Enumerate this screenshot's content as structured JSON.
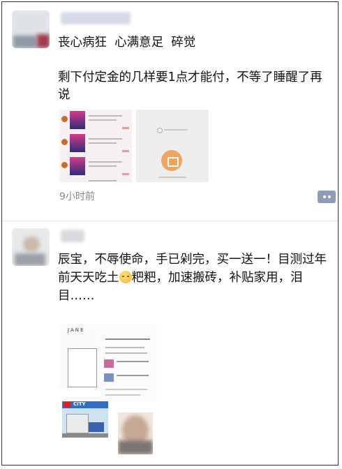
{
  "posts": [
    {
      "text": "丧心病狂  心满意足  碎觉\n\n剩下付定金的几样要1点才能付，不等了睡醒了再说",
      "time": "9小时前"
    },
    {
      "text": "辰宝，不辱使命，手已剁完，买一送一！目测过年前天天吃土",
      "text_after_emoji": "粑粑，加速搬砖，补贴家用，泪目……",
      "images": {
        "jane_label": "JANE",
        "lego_label": "CITY"
      }
    }
  ],
  "icons": {
    "more": "comment-more-icon",
    "emoji": "smiling-face-icon"
  },
  "colors": {
    "accent": "#8d9db5",
    "time": "#8a8a8a"
  }
}
